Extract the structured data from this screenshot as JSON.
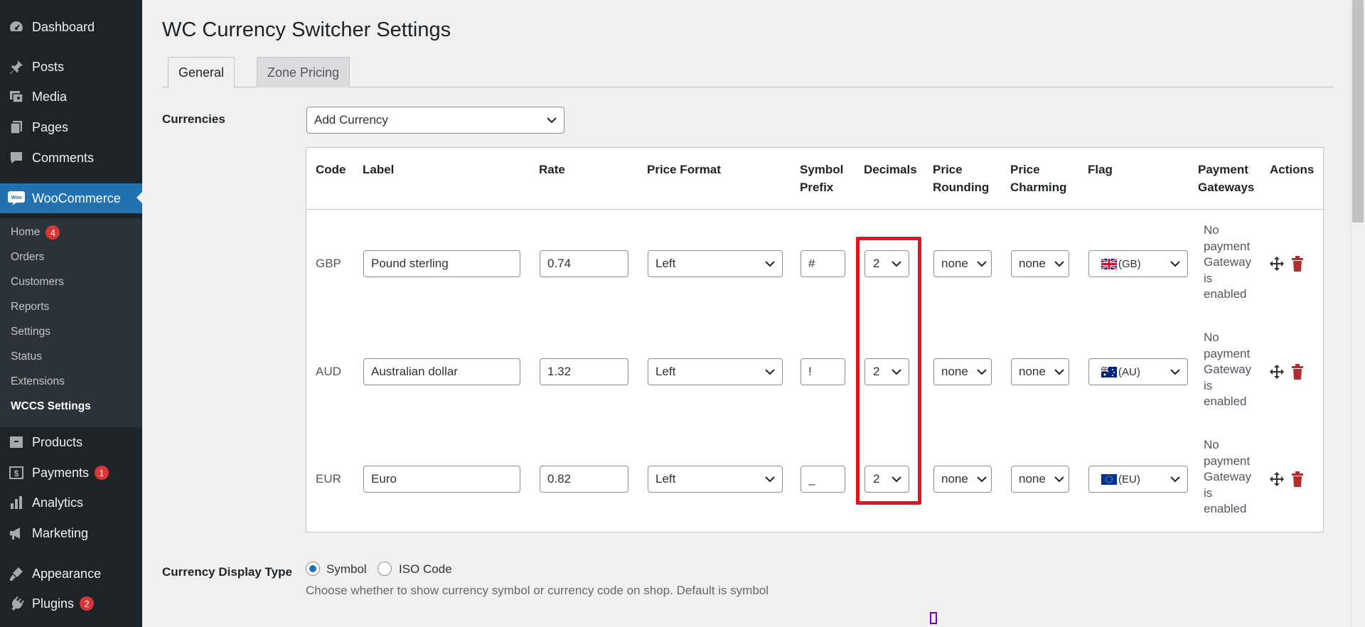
{
  "sidebar": {
    "top_items": [
      {
        "label": "Dashboard",
        "icon": "dashboard-icon"
      },
      {
        "label": "Posts",
        "icon": "pin-icon"
      },
      {
        "label": "Media",
        "icon": "media-icon"
      },
      {
        "label": "Pages",
        "icon": "pages-icon"
      },
      {
        "label": "Comments",
        "icon": "comments-icon"
      }
    ],
    "woocommerce": {
      "label": "WooCommerce",
      "icon_text": "Woo"
    },
    "submenu": [
      {
        "label": "Home",
        "badge": "4"
      },
      {
        "label": "Orders"
      },
      {
        "label": "Customers"
      },
      {
        "label": "Reports"
      },
      {
        "label": "Settings"
      },
      {
        "label": "Status"
      },
      {
        "label": "Extensions"
      },
      {
        "label": "WCCS Settings"
      }
    ],
    "bottom_items": [
      {
        "label": "Products",
        "icon": "products-icon"
      },
      {
        "label": "Payments",
        "icon": "payments-icon",
        "badge": "1"
      },
      {
        "label": "Analytics",
        "icon": "analytics-icon"
      },
      {
        "label": "Marketing",
        "icon": "marketing-icon"
      },
      {
        "label": "Appearance",
        "icon": "appearance-icon"
      },
      {
        "label": "Plugins",
        "icon": "plugins-icon",
        "badge": "2"
      }
    ]
  },
  "page": {
    "title": "WC Currency Switcher Settings",
    "tabs": [
      {
        "label": "General"
      },
      {
        "label": "Zone Pricing"
      }
    ]
  },
  "currencies": {
    "label": "Currencies",
    "add_select": "Add Currency",
    "headers": {
      "code": "Code",
      "label": "Label",
      "rate": "Rate",
      "price_format": "Price Format",
      "symbol_prefix": [
        "Symbol",
        "Prefix"
      ],
      "decimals": "Decimals",
      "price_rounding": [
        "Price",
        "Rounding"
      ],
      "price_charming": [
        "Price",
        "Charming"
      ],
      "flag": "Flag",
      "payment_gateways": [
        "Payment",
        "Gateways"
      ],
      "actions": "Actions"
    },
    "rows": [
      {
        "code": "GBP",
        "label": "Pound sterling",
        "rate": "0.74",
        "format": "Left",
        "prefix": "#",
        "decimals": "2",
        "rounding": "none",
        "charming": "none",
        "flag": "(GB)",
        "gateway": [
          "No",
          "payment",
          "Gateway",
          "is",
          "enabled"
        ]
      },
      {
        "code": "AUD",
        "label": "Australian dollar",
        "rate": "1.32",
        "format": "Left",
        "prefix": "!",
        "decimals": "2",
        "rounding": "none",
        "charming": "none",
        "flag": "(AU)",
        "gateway": [
          "No",
          "payment",
          "Gateway",
          "is",
          "enabled"
        ]
      },
      {
        "code": "EUR",
        "label": "Euro",
        "rate": "0.82",
        "format": "Left",
        "prefix": "_",
        "decimals": "2",
        "rounding": "none",
        "charming": "none",
        "flag": "(EU)",
        "gateway": [
          "No",
          "payment",
          "Gateway",
          "is",
          "enabled"
        ]
      }
    ]
  },
  "display_type": {
    "label": "Currency Display Type",
    "options": [
      {
        "label": "Symbol",
        "checked": true
      },
      {
        "label": "ISO Code",
        "checked": false
      }
    ],
    "description": "Choose whether to show currency symbol or currency code on shop. Default is symbol"
  },
  "colors": {
    "sidebar_bg": "#1d2327",
    "accent": "#2271b1",
    "badge": "#d63638",
    "highlight": "#e0151f",
    "delete": "#b32d2e"
  }
}
